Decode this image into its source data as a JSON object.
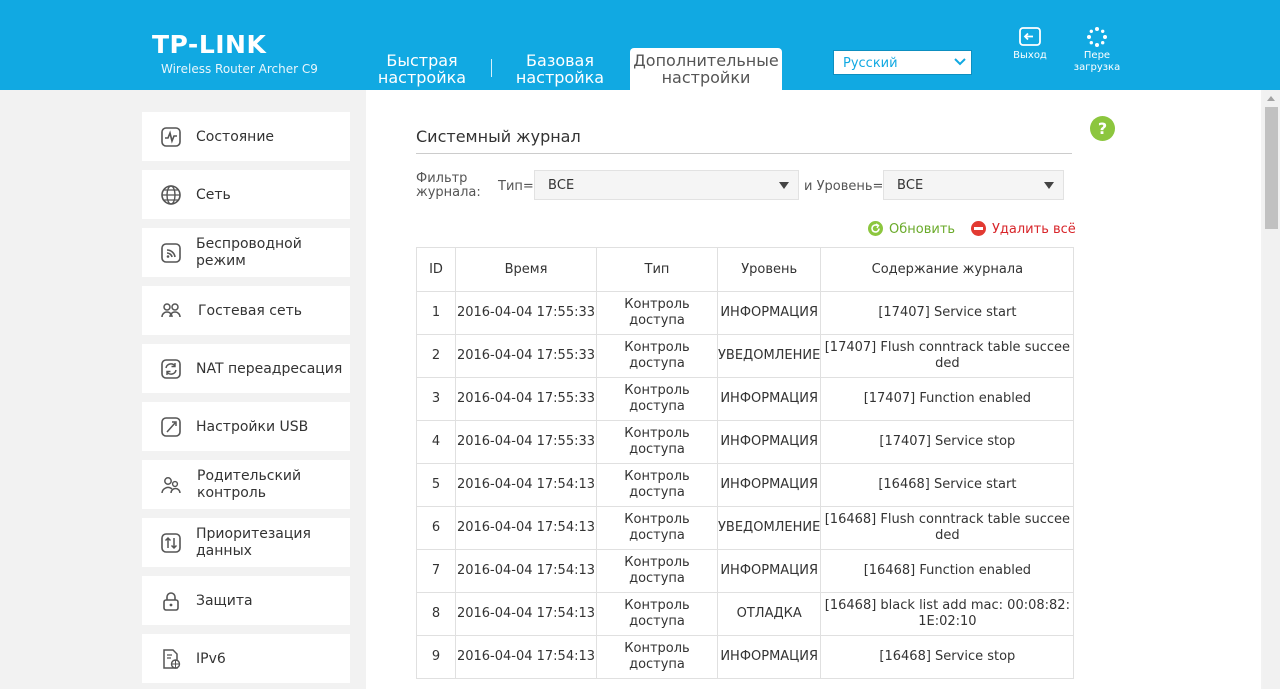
{
  "header": {
    "brand": "TP-LINK",
    "model": "Wireless Router Archer C9",
    "tabs": [
      {
        "label": "Быстрая настройка"
      },
      {
        "label": "Базовая настройка"
      },
      {
        "label": "Дополнительные настройки",
        "active": true
      }
    ],
    "language": "Русский",
    "logout_label": "Выход",
    "reboot_label": "Пере загрузка",
    "accent_color": "#11a9e2"
  },
  "sidebar": {
    "items": [
      {
        "label": "Состояние",
        "icon": "status-icon"
      },
      {
        "label": "Сеть",
        "icon": "globe-icon"
      },
      {
        "label": "Беспроводной режим",
        "icon": "wireless-icon"
      },
      {
        "label": "Гостевая сеть",
        "icon": "guest-network-icon"
      },
      {
        "label": "NAT переадресация",
        "icon": "nat-icon"
      },
      {
        "label": "Настройки USB",
        "icon": "usb-icon"
      },
      {
        "label": "Родительский контроль",
        "icon": "parental-control-icon"
      },
      {
        "label": "Приоритезация данных",
        "icon": "qos-icon"
      },
      {
        "label": "Защита",
        "icon": "lock-icon"
      },
      {
        "label": "IPv6",
        "icon": "ipv6-icon"
      }
    ]
  },
  "main": {
    "title": "Системный журнал",
    "help_icon": "?",
    "filter": {
      "label": "Фильтр журнала:",
      "type_label": "Тип=",
      "type_value": "ВСЕ",
      "level_label": "и Уровень=",
      "level_value": "ВСЕ"
    },
    "actions": {
      "refresh_label": "Обновить",
      "delete_all_label": "Удалить всё"
    },
    "table": {
      "columns": [
        "ID",
        "Время",
        "Тип",
        "Уровень",
        "Содержание журнала"
      ],
      "rows": [
        [
          "1",
          "2016-04-04 17:55:33",
          "Контроль доступа",
          "ИНФОРМАЦИЯ",
          "[17407] Service start"
        ],
        [
          "2",
          "2016-04-04 17:55:33",
          "Контроль доступа",
          "УВЕДОМЛЕНИЕ",
          "[17407] Flush conntrack table succeeded"
        ],
        [
          "3",
          "2016-04-04 17:55:33",
          "Контроль доступа",
          "ИНФОРМАЦИЯ",
          "[17407] Function enabled"
        ],
        [
          "4",
          "2016-04-04 17:55:33",
          "Контроль доступа",
          "ИНФОРМАЦИЯ",
          "[17407] Service stop"
        ],
        [
          "5",
          "2016-04-04 17:54:13",
          "Контроль доступа",
          "ИНФОРМАЦИЯ",
          "[16468] Service start"
        ],
        [
          "6",
          "2016-04-04 17:54:13",
          "Контроль доступа",
          "УВЕДОМЛЕНИЕ",
          "[16468] Flush conntrack table succeeded"
        ],
        [
          "7",
          "2016-04-04 17:54:13",
          "Контроль доступа",
          "ИНФОРМАЦИЯ",
          "[16468] Function enabled"
        ],
        [
          "8",
          "2016-04-04 17:54:13",
          "Контроль доступа",
          "ОТЛАДКА",
          "[16468] black list add mac: 00:08:82:1E:02:10"
        ],
        [
          "9",
          "2016-04-04 17:54:13",
          "Контроль доступа",
          "ИНФОРМАЦИЯ",
          "[16468] Service stop"
        ]
      ]
    }
  }
}
